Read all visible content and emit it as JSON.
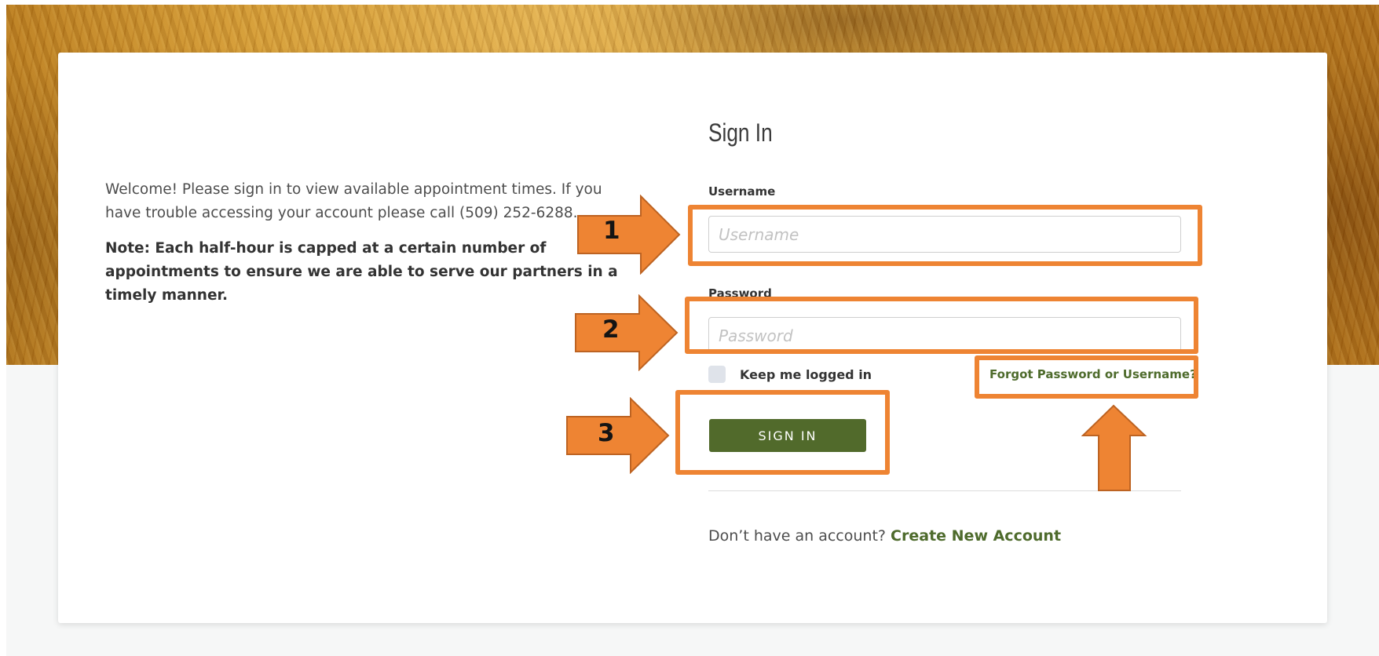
{
  "intro": {
    "welcome": "Welcome! Please sign in to view available appointment times. If you have trouble accessing your account please call (509) 252-6288.",
    "note": "Note: Each half-hour is capped at a certain number of appointments to ensure we are able to serve our partners in a timely manner."
  },
  "form": {
    "title": "Sign In",
    "username_label": "Username",
    "username_placeholder": "Username",
    "username_value": "",
    "password_label": "Password",
    "password_placeholder": "Password",
    "password_value": "",
    "keep_logged_in_label": "Keep me logged in",
    "keep_logged_in_checked": false,
    "forgot_link": "Forgot Password or Username?",
    "sign_in_button": "SIGN IN",
    "no_account_text": "Don’t have an account?",
    "create_account_link": "Create New Account"
  },
  "annotations": {
    "labels": [
      "1",
      "2",
      "3"
    ],
    "color": "#ee8433"
  },
  "colors": {
    "brand_green": "#516a2b",
    "link_green": "#4e6b2c"
  }
}
